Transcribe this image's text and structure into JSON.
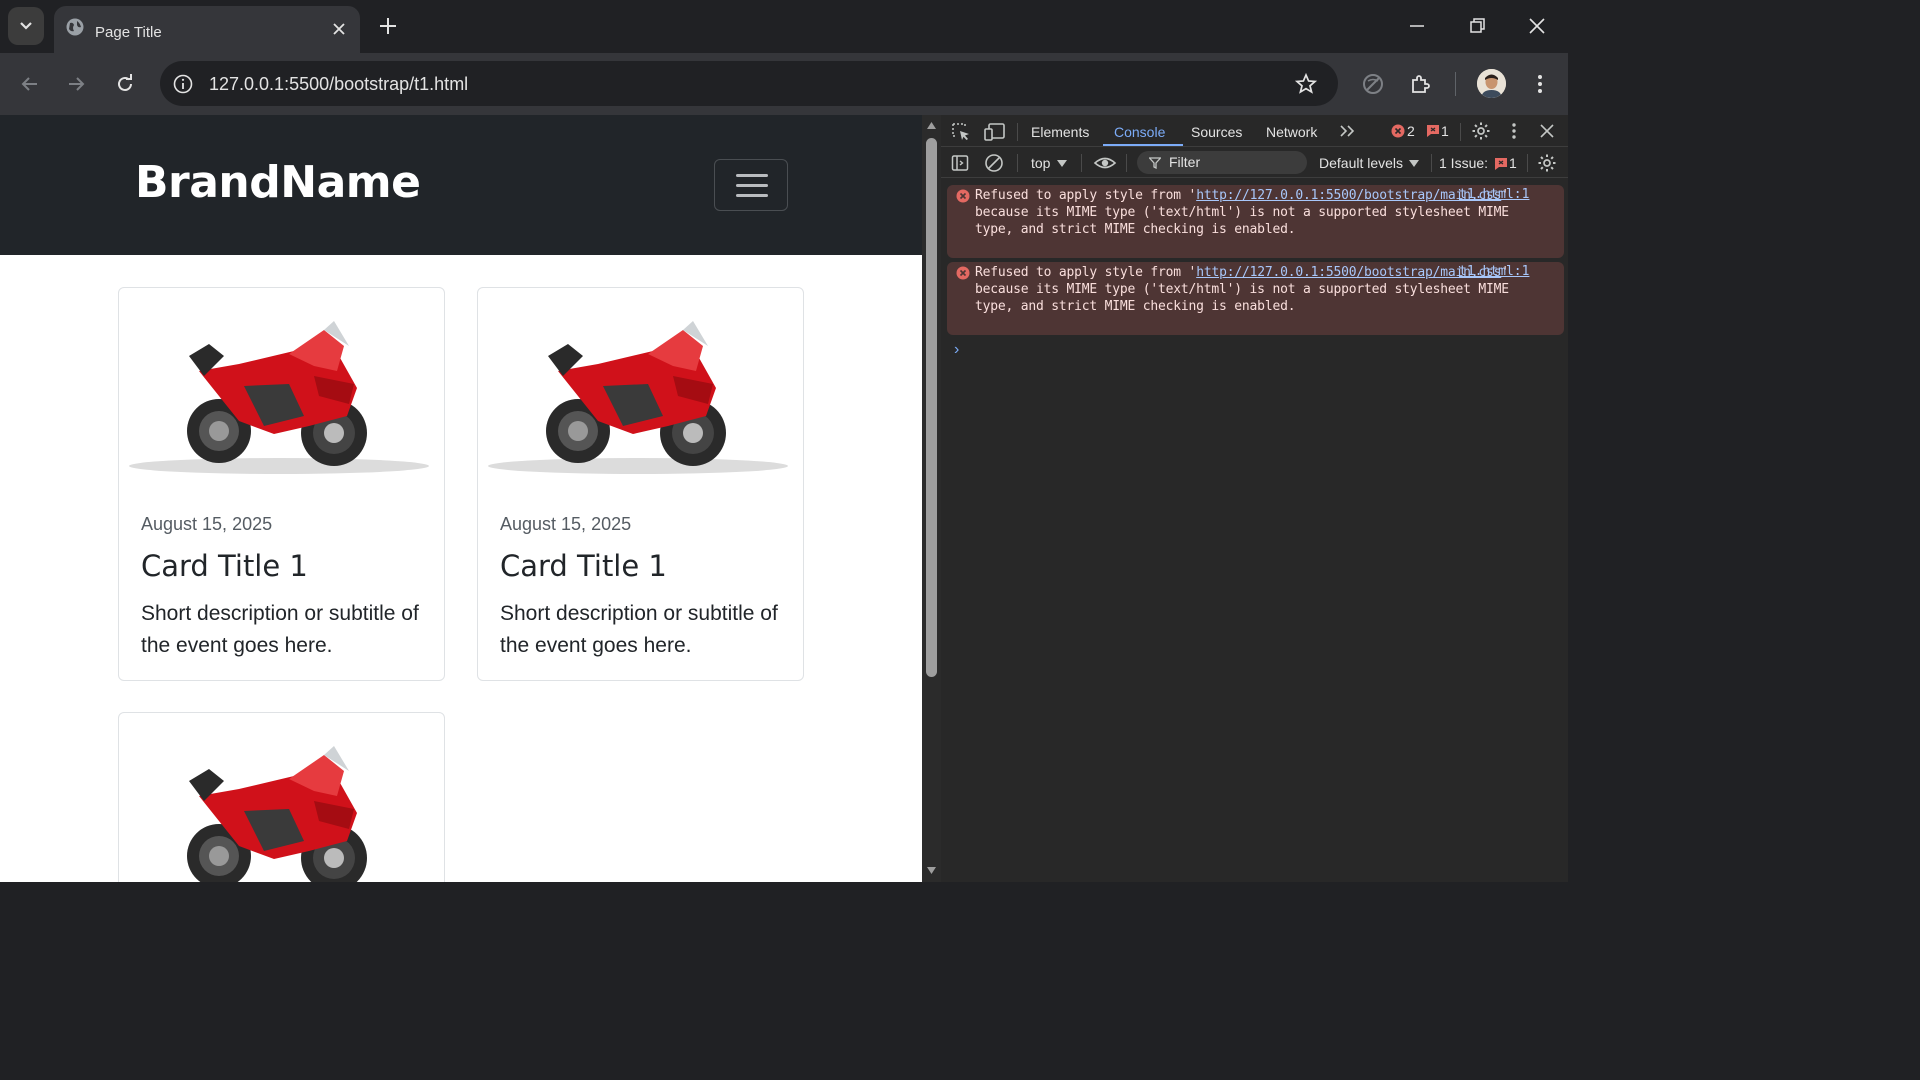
{
  "browser": {
    "tab_title": "Page Title",
    "url": "127.0.0.1:5500/bootstrap/t1.html"
  },
  "page": {
    "brand": "BrandName",
    "cards": [
      {
        "date": "August 15, 2025",
        "title": "Card Title 1",
        "description": "Short description or subtitle of the event goes here."
      },
      {
        "date": "August 15, 2025",
        "title": "Card Title 1",
        "description": "Short description or subtitle of the event goes here."
      },
      {
        "date": "",
        "title": "",
        "description": ""
      }
    ]
  },
  "devtools": {
    "tabs": [
      "Elements",
      "Console",
      "Sources",
      "Network"
    ],
    "active_tab": "Console",
    "error_count": "2",
    "issue_count_badge": "1",
    "context": "top",
    "filter_placeholder": "Filter",
    "levels": "Default levels",
    "issues_label": "1 Issue:",
    "issues_count": "1",
    "messages": [
      {
        "prefix": "Refused to apply style from '",
        "link": "http://127.0.0.1:5500/bootstrap/main.css",
        "suffix": "' because its MIME type ('text/html') is not a supported stylesheet MIME type, and strict MIME checking is enabled.",
        "source": "t1.html:1"
      },
      {
        "prefix": "Refused to apply style from '",
        "link": "http://127.0.0.1:5500/bootstrap/main.css",
        "suffix": "' because its MIME type ('text/html') is not a supported stylesheet MIME type, and strict MIME checking is enabled.",
        "source": "t1.html:1"
      }
    ],
    "prompt": "›"
  },
  "colors": {
    "navbar_bg": "#212529",
    "error_bg": "#4e3534",
    "accent": "#7cacf8",
    "bike_red": "#d0111a"
  }
}
